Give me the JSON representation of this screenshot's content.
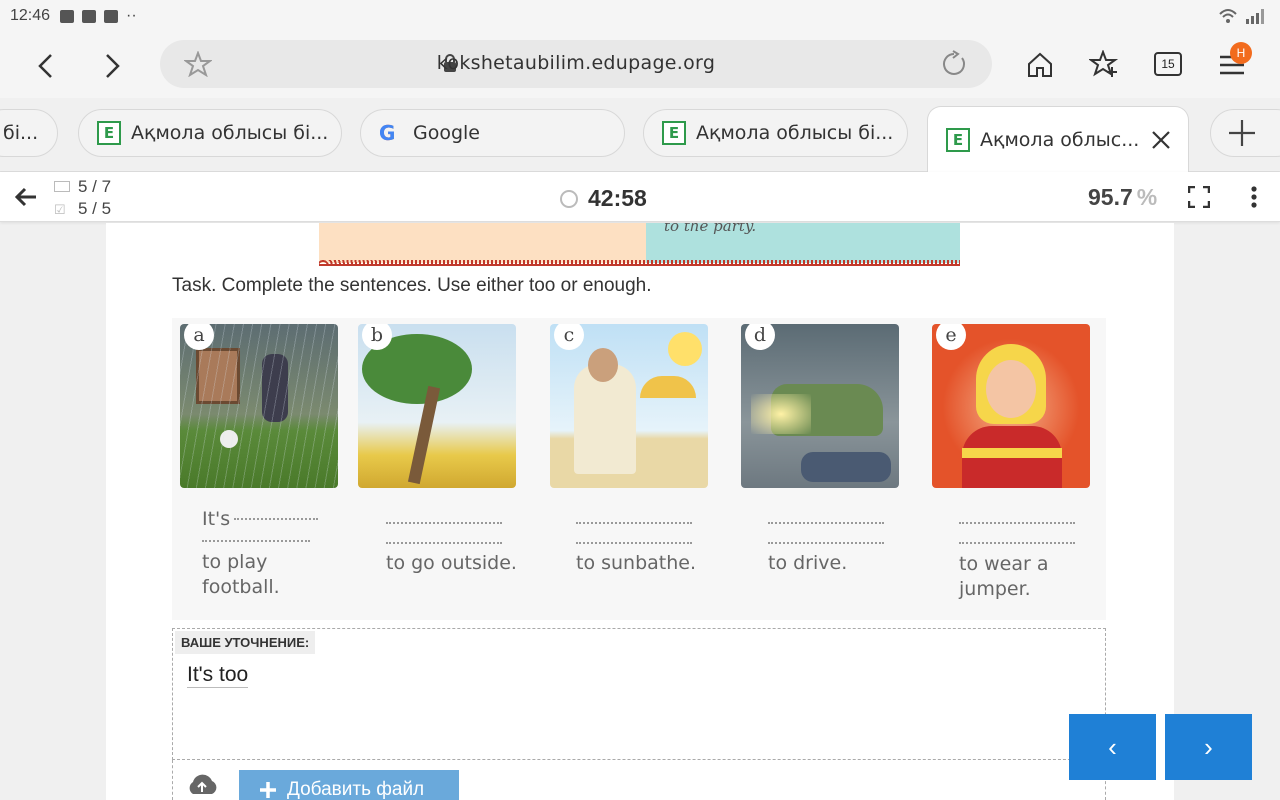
{
  "status_bar": {
    "time": "12:46"
  },
  "browser": {
    "url": "kokshetaubilim.edupage.org",
    "tab_count": "15",
    "menu_badge": "H",
    "tabs": [
      {
        "title": "бі..."
      },
      {
        "title": "Ақмола облысы бі..."
      },
      {
        "title": "Google"
      },
      {
        "title": "Ақмола облысы бі..."
      },
      {
        "title": "Ақмола облыс..."
      }
    ]
  },
  "toolbar": {
    "screens": "5 / 7",
    "answered": "5 / 5",
    "timer": "42:58",
    "score": "95.7",
    "score_unit": "%"
  },
  "content": {
    "banner_text": "to the party.",
    "task": "Task. Complete the sentences. Use either too or enough.",
    "exercises": [
      {
        "letter": "a",
        "prefix": "It's",
        "caption": "to play football."
      },
      {
        "letter": "b",
        "prefix": "",
        "caption": "to go outside."
      },
      {
        "letter": "c",
        "prefix": "",
        "caption": "to sunbathe."
      },
      {
        "letter": "d",
        "prefix": "",
        "caption": "to drive."
      },
      {
        "letter": "e",
        "prefix": "",
        "caption": "to wear a jumper."
      }
    ],
    "answer_label": "ВАШЕ УТОЧНЕНИЕ:",
    "answer_value": "It's too",
    "add_file_label": "Добавить файл"
  },
  "pager": {
    "prev": "‹",
    "next": "›"
  },
  "colors": {
    "accent": "#1f80d6",
    "add_file_bg": "#6aa9db",
    "badge": "#f26b1d"
  }
}
